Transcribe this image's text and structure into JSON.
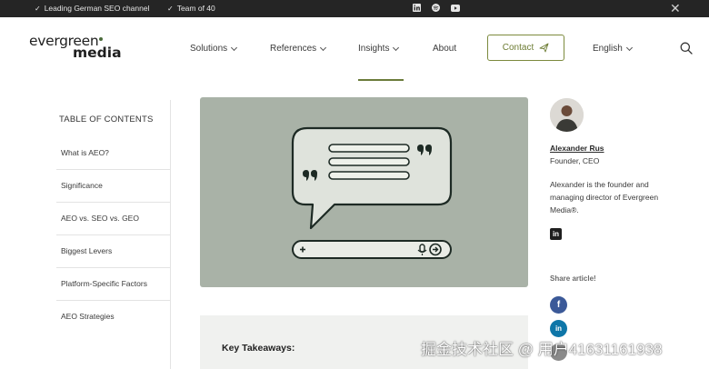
{
  "topbar": {
    "usp_1": "Leading German SEO channel",
    "usp_2": "Team of 40",
    "social_icons": [
      "linkedin-icon",
      "spotify-icon",
      "youtube-icon"
    ],
    "close_glyph": "✕"
  },
  "header": {
    "logo_line1": "evergreen",
    "logo_line2": "media",
    "nav": {
      "solutions": "Solutions",
      "references": "References",
      "insights": "Insights",
      "about": "About",
      "contact": "Contact",
      "language": "English"
    }
  },
  "toc": {
    "title": "TABLE OF CONTENTS",
    "items": [
      "What is AEO?",
      "Significance",
      "AEO vs. SEO vs. GEO",
      "Biggest Levers",
      "Platform-Specific Factors",
      "AEO Strategies"
    ]
  },
  "hero": {
    "image_icon": "chat-bubble-with-search-bar-illustration"
  },
  "takeaways": {
    "title": "Key Takeaways:"
  },
  "author": {
    "name": "Alexander Rus",
    "role": "Founder, CEO",
    "bio": "Alexander is the founder and managing director of Evergreen Media®.",
    "linkedin_glyph": "in"
  },
  "share": {
    "label": "Share article!",
    "facebook_glyph": "f",
    "linkedin_glyph": "in"
  },
  "watermark": {
    "text": "掘金技术社区 @ 用户41631161938"
  },
  "colors": {
    "topbar": "#252525",
    "accent_green": "#6d7c33",
    "hero_bg": "#a9b2a7",
    "facebook": "#3b5998",
    "linkedin": "#0e76a8"
  }
}
